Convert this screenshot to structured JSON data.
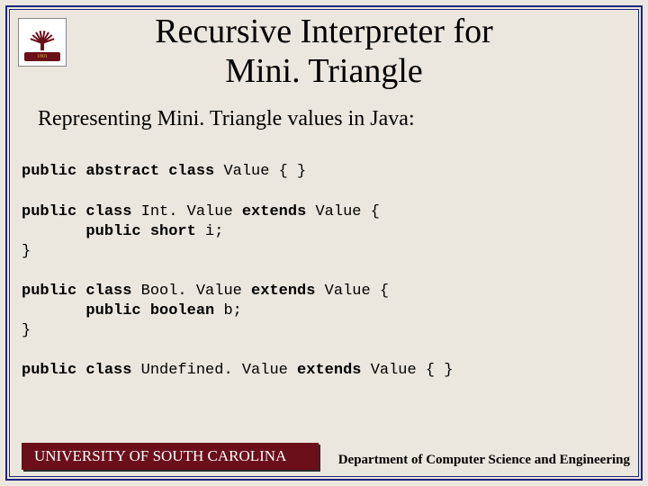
{
  "title_line1": "Recursive Interpreter for",
  "title_line2": "Mini. Triangle",
  "subtitle": "Representing Mini. Triangle values in Java:",
  "logo_year": "1801",
  "code": {
    "l1a": "public abstract class ",
    "l1b": "Value",
    "l1c": " { }",
    "l2a": "public class ",
    "l2b": "Int. Value",
    "l2c": " extends ",
    "l2d": "Value",
    "l2e": " {",
    "l3a": "       public short ",
    "l3b": "i",
    "l3c": ";",
    "l4": "}",
    "l5a": "public class ",
    "l5b": "Bool. Value",
    "l5c": " extends ",
    "l5d": "Value",
    "l5e": " {",
    "l6a": "       public boolean ",
    "l6b": "b",
    "l6c": ";",
    "l7": "}",
    "l8a": "public class ",
    "l8b": "Undefined. Value",
    "l8c": " extends ",
    "l8d": "Value",
    "l8e": " { }"
  },
  "footer_left": "UNIVERSITY OF SOUTH CAROLINA",
  "footer_right": "Department of Computer Science and Engineering"
}
